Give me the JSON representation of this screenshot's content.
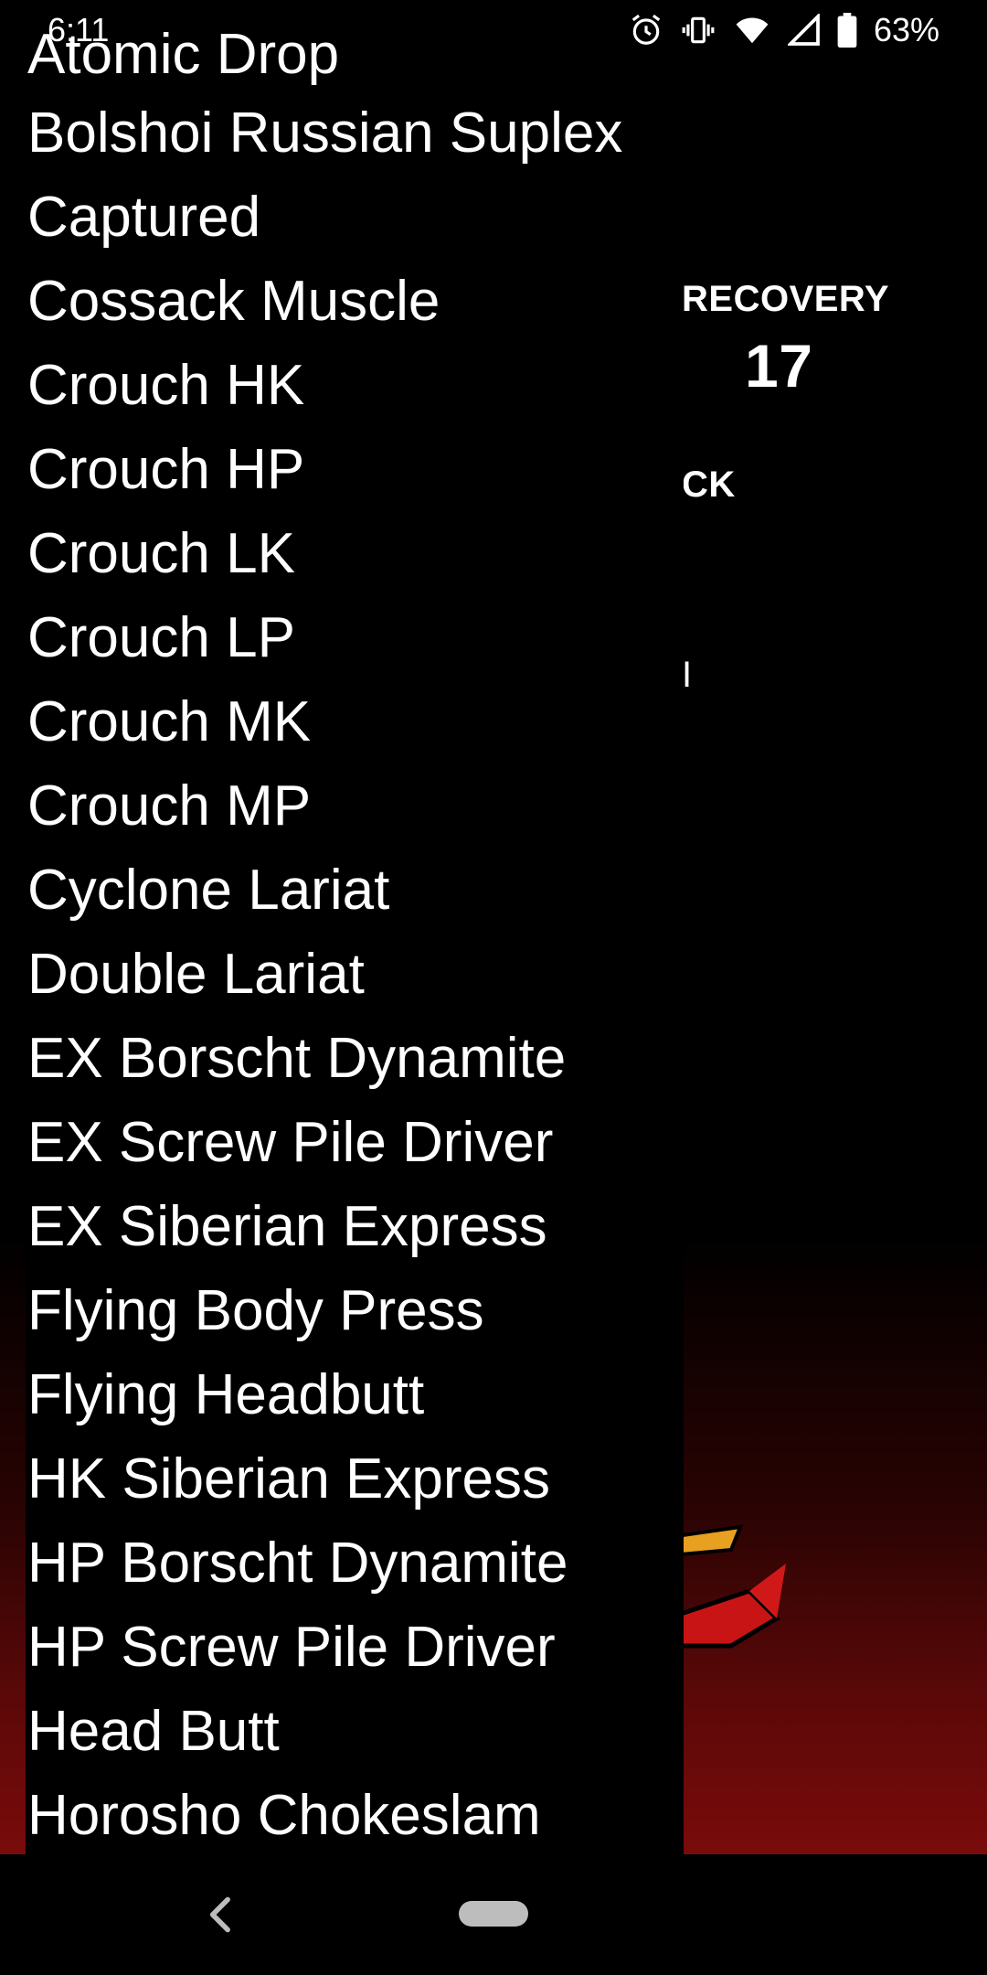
{
  "status_bar": {
    "time": "6:11",
    "battery_percent": "63%",
    "icons": [
      "alarm-icon",
      "vibrate-icon",
      "wifi-icon",
      "signal-icon",
      "battery-icon"
    ]
  },
  "background": {
    "recovery_label": "RECOVERY",
    "recovery_value": "17",
    "partial_label_1": "CK",
    "partial_label_2": "I"
  },
  "dropdown": {
    "items": [
      "Atomic Drop",
      "Bolshoi Russian Suplex",
      "Captured",
      "Cossack Muscle",
      "Crouch HK",
      "Crouch HP",
      "Crouch LK",
      "Crouch LP",
      "Crouch MK",
      "Crouch MP",
      "Cyclone Lariat",
      "Double Lariat",
      "EX Borscht Dynamite",
      "EX Screw Pile Driver",
      "EX Siberian Express",
      "Flying Body Press",
      "Flying Headbutt",
      "HK Siberian Express",
      "HP Borscht Dynamite",
      "HP Screw Pile Driver",
      "Head Butt",
      "Horosho Chokeslam"
    ]
  },
  "nav_bar": {
    "icons": [
      "back-icon",
      "home-pill"
    ]
  },
  "colors": {
    "background": "#000000",
    "text": "#ffffff",
    "bg_gradient_bottom": "#7a0b0b"
  }
}
